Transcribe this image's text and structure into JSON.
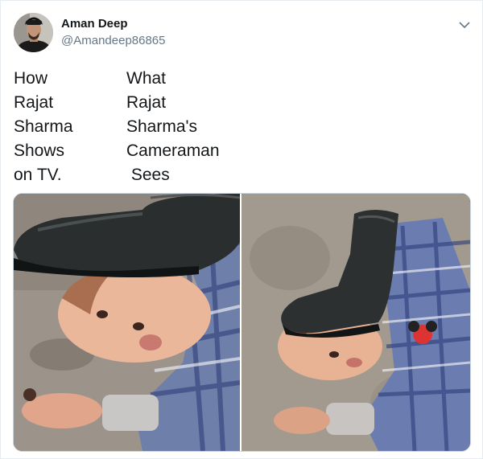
{
  "tweet": {
    "author": {
      "name": "Aman Deep",
      "handle": "@Amandeep86865"
    },
    "text_left_lines": [
      "How",
      "Rajat",
      "Sharma",
      "Shows",
      "on TV."
    ],
    "text_right_lines": [
      "What",
      "Rajat",
      "Sharma's",
      "Cameraman",
      " Sees"
    ],
    "media": [
      {
        "subject": "child lying on floor with a rubber boot resting on head, camera at ground level"
      },
      {
        "subject": "child lying on floor with a rubber boot on head, viewed from above"
      }
    ]
  },
  "icons": {
    "caret": "chevron-down-icon"
  },
  "colors": {
    "text": "#14171a",
    "secondary_text": "#657786",
    "border": "#e6ecf0"
  }
}
